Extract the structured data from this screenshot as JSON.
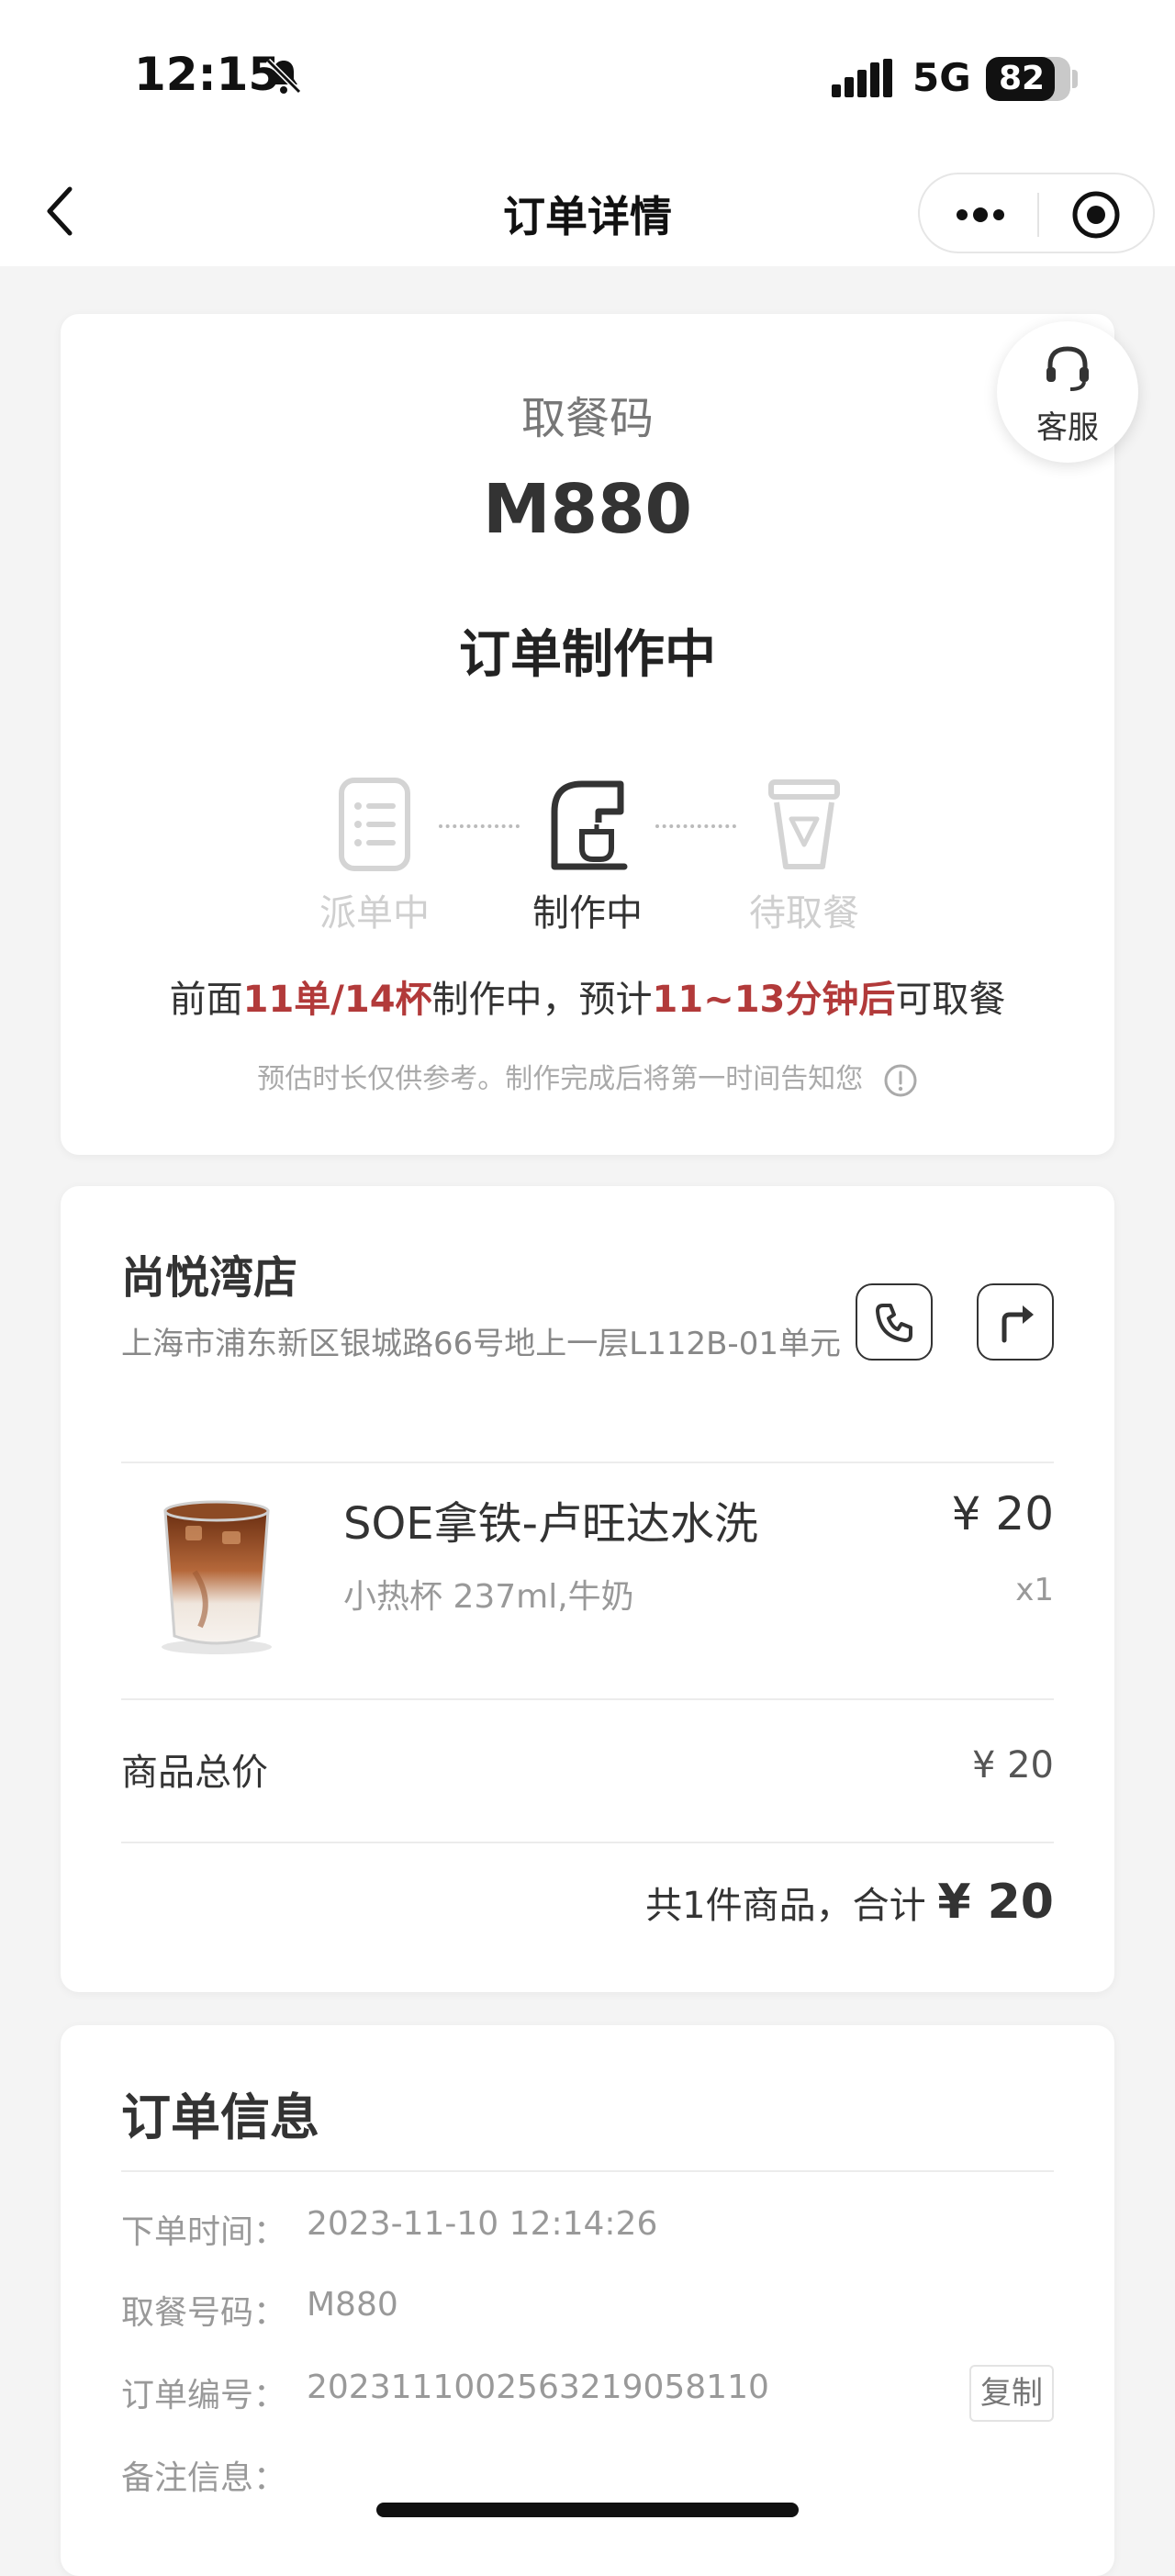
{
  "status_bar": {
    "time": "12:15",
    "network": "5G",
    "battery": "82",
    "battery_level": 0.82
  },
  "nav": {
    "title": "订单详情"
  },
  "customer_service": {
    "label": "客服"
  },
  "pickup": {
    "label": "取餐码",
    "code": "M880",
    "status": "订单制作中",
    "steps": [
      {
        "label": "派单中",
        "active": false
      },
      {
        "label": "制作中",
        "active": true
      },
      {
        "label": "待取餐",
        "active": false
      }
    ],
    "eta": {
      "prefix": "前面",
      "queue": "11单/14杯",
      "middle": "制作中，预计",
      "minutes": "11~13分钟后",
      "suffix": "可取餐"
    },
    "note": "预估时长仅供参考。制作完成后将第一时间告知您"
  },
  "store": {
    "name": "尚悦湾店",
    "address": "上海市浦东新区银城路66号地上一层L112B-01单元",
    "product": {
      "name": "SOE拿铁-卢旺达水洗",
      "spec": "小热杯 237ml,牛奶",
      "price": "¥ 20",
      "qty": "x1"
    },
    "subtotal_label": "商品总价",
    "subtotal_value": "¥ 20",
    "total_prefix": "共1件商品，合计",
    "total_value": "¥ 20"
  },
  "order_info": {
    "title": "订单信息",
    "rows": [
      {
        "label": "下单时间：",
        "value": "2023-11-10 12:14:26"
      },
      {
        "label": "取餐号码：",
        "value": "M880"
      },
      {
        "label": "订单编号：",
        "value": "20231110025632190581​10"
      },
      {
        "label": "备注信息：",
        "value": ""
      }
    ],
    "copy_label": "复制"
  },
  "colors": {
    "highlight": "#b23a3a",
    "background": "#f4f4f4"
  }
}
